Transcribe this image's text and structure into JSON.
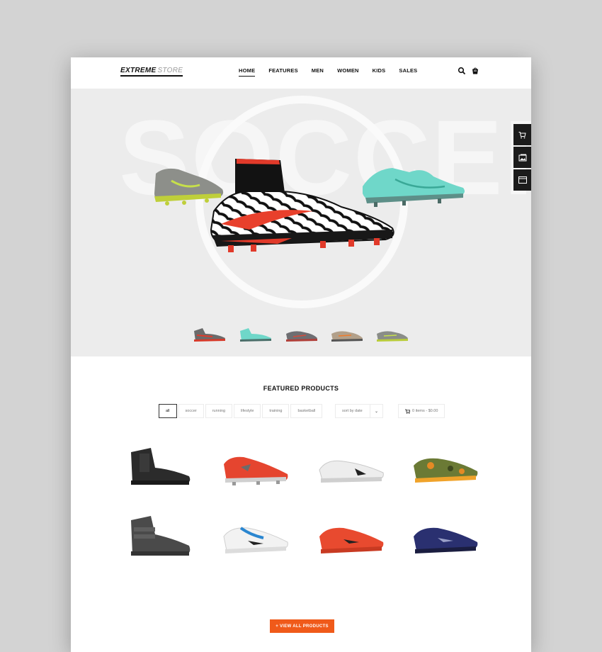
{
  "brand": {
    "part1": "EXTREME",
    "part2": "STORE"
  },
  "nav": [
    "HOME",
    "FEATURES",
    "MEN",
    "WOMEN",
    "KIDS",
    "SALES"
  ],
  "hero": {
    "background_word": "SOCCER"
  },
  "thumbnails": [
    {
      "icon": "shoe-thumb-black-red"
    },
    {
      "icon": "shoe-thumb-teal"
    },
    {
      "icon": "shoe-thumb-grey"
    },
    {
      "icon": "shoe-thumb-tan"
    },
    {
      "icon": "shoe-thumb-grey-green"
    }
  ],
  "side_toolbar": [
    {
      "icon": "cart-icon"
    },
    {
      "icon": "image-icon"
    },
    {
      "icon": "window-icon"
    }
  ],
  "featured": {
    "title": "FEATURED PRODUCTS",
    "filters": [
      "all",
      "soccer",
      "running",
      "lifestyle",
      "training",
      "basketball"
    ],
    "active_filter": "all",
    "sort_label": "sort by date",
    "cart_summary": "0 items - $0.00",
    "view_all_label": "+ VIEW ALL PRODUCTS"
  },
  "products": [
    {
      "name": "black-high-top",
      "color": "#2b2b2b"
    },
    {
      "name": "red-soccer-cleat",
      "color": "#e5452f"
    },
    {
      "name": "white-spike",
      "color": "#e6e6e6"
    },
    {
      "name": "camo-runner",
      "color": "#6b7a35"
    },
    {
      "name": "grey-strap-high-top",
      "color": "#4a4a4a"
    },
    {
      "name": "white-blue-tennis",
      "color": "#2a86d0"
    },
    {
      "name": "red-runner",
      "color": "#e84a2f"
    },
    {
      "name": "navy-trainer",
      "color": "#2a3070"
    }
  ],
  "colors": {
    "accent": "#f05a1a",
    "dark": "#1c1c1c"
  }
}
